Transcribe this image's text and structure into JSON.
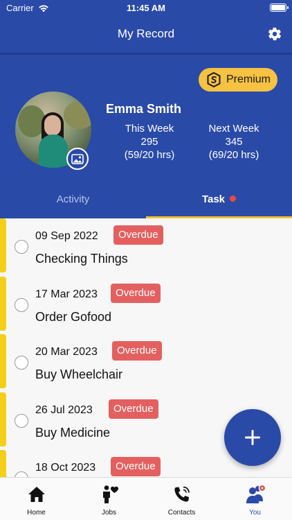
{
  "status_bar": {
    "carrier": "Carrier",
    "time": "11:45 AM"
  },
  "nav": {
    "title": "My Record",
    "settings_icon": "gear-icon"
  },
  "profile": {
    "premium_label": "Premium",
    "name": "Emma Smith",
    "this_week": {
      "label": "This Week",
      "value": "295",
      "hours": "(59/20 hrs)"
    },
    "next_week": {
      "label": "Next Week",
      "value": "345",
      "hours": "(69/20 hrs)"
    }
  },
  "tabs": [
    {
      "label": "Activity",
      "active": false
    },
    {
      "label": "Task",
      "active": true,
      "has_notification": true
    }
  ],
  "tasks": [
    {
      "date": "09 Sep 2022",
      "status": "Overdue",
      "title": "Checking Things"
    },
    {
      "date": "17 Mar 2023",
      "status": "Overdue",
      "title": "Order Gofood"
    },
    {
      "date": "20 Mar 2023",
      "status": "Overdue",
      "title": "Buy Wheelchair"
    },
    {
      "date": "26 Jul 2023",
      "status": "Overdue",
      "title": "Buy Medicine"
    },
    {
      "date": "18 Oct 2023",
      "status": "Overdue",
      "title": ""
    }
  ],
  "tab_bar": [
    {
      "label": "Home",
      "icon": "home-icon",
      "active": false
    },
    {
      "label": "Jobs",
      "icon": "jobs-icon",
      "active": false
    },
    {
      "label": "Contacts",
      "icon": "phone-icon",
      "active": false
    },
    {
      "label": "You",
      "icon": "user-group-icon",
      "active": true
    }
  ],
  "colors": {
    "primary": "#2a4aa8",
    "premium": "#f5c242",
    "overdue": "#e46060",
    "task_stripe": "#f4cf19",
    "notification": "#e84a3f"
  }
}
